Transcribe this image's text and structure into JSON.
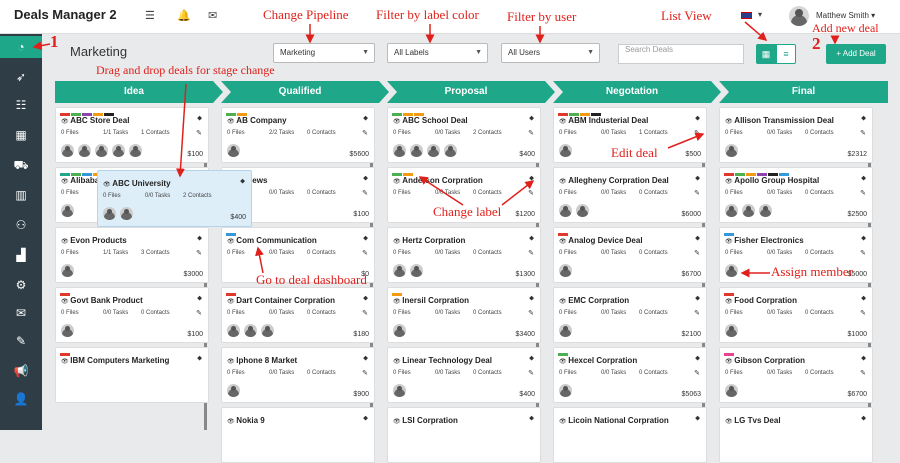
{
  "app": {
    "title": "Deals Manager 2"
  },
  "header": {
    "user_name": "Matthew Smith ▾",
    "flag_caret": "▾",
    "icons": [
      "hamburger-icon",
      "bell-icon",
      "mail-icon"
    ]
  },
  "sidebar": {
    "items": [
      "dashboard-icon",
      "rocket-icon",
      "sliders-icon",
      "calendar-icon",
      "cart-icon",
      "building-icon",
      "team-icon",
      "chart-icon",
      "gear-icon",
      "mail-icon",
      "tag-icon",
      "megaphone-icon",
      "user-icon"
    ]
  },
  "toolbar": {
    "page_title": "Marketing",
    "pipeline": "Marketing",
    "labels": "All Labels",
    "users": "All Users",
    "search_placeholder": "Search Deals",
    "add_deal": "+ Add Deal",
    "grid_icon": "▦",
    "list_icon": "≡"
  },
  "stages": [
    "Idea",
    "Qualified",
    "Proposal",
    "Negotation",
    "Final"
  ],
  "label_colors": {
    "red": "#e0392b",
    "green": "#4caf50",
    "orange": "#f39c12",
    "purple": "#8e44ad",
    "black": "#222222",
    "blue": "#3498db",
    "teal": "#1fa78a",
    "pink": "#e84393"
  },
  "columns": [
    {
      "cards": [
        {
          "title": "ABC Store Deal",
          "files": "0 Files",
          "tasks": "1/1 Tasks",
          "contacts": "1 Contacts",
          "amount": "$100",
          "labels": [
            "red",
            "green",
            "purple",
            "orange",
            "black"
          ],
          "avatars": 5
        },
        {
          "title": "Alibaba Website Marketing",
          "files": "0 Files",
          "tasks": "0/0 Tasks",
          "contacts": "0 Contacts",
          "amount": "$100",
          "labels": [
            "teal",
            "green",
            "blue",
            "orange"
          ],
          "avatars": 1
        },
        {
          "title": "Evon Products",
          "files": "0 Files",
          "tasks": "1/1 Tasks",
          "contacts": "3 Contacts",
          "amount": "$3000",
          "labels": [],
          "avatars": 1
        },
        {
          "title": "Govt Bank Product",
          "files": "0 Files",
          "tasks": "0/0 Tasks",
          "contacts": "0 Contacts",
          "amount": "$100",
          "labels": [
            "red"
          ],
          "avatars": 1
        },
        {
          "title": "IBM Computers Marketing",
          "files": "",
          "tasks": "",
          "contacts": "",
          "amount": "",
          "labels": [
            "red"
          ],
          "avatars": 0
        }
      ]
    },
    {
      "cards": [
        {
          "title": "AB Company",
          "files": "0 Files",
          "tasks": "2/2 Tasks",
          "contacts": "0 Contacts",
          "amount": "$5600",
          "labels": [
            "green",
            "orange"
          ],
          "avatars": 1
        },
        {
          "title": "IC News",
          "files": "0 Files",
          "tasks": "0/0 Tasks",
          "contacts": "0 Contacts",
          "amount": "$100",
          "labels": [],
          "avatars": 1
        },
        {
          "title": "Com Communication",
          "files": "0 Files",
          "tasks": "0/0 Tasks",
          "contacts": "0 Contacts",
          "amount": "$0",
          "labels": [
            "blue"
          ],
          "avatars": 0
        },
        {
          "title": "Dart Container Corpration",
          "files": "0 Files",
          "tasks": "0/0 Tasks",
          "contacts": "0 Contacts",
          "amount": "$180",
          "labels": [
            "red"
          ],
          "avatars": 3
        },
        {
          "title": "Iphone 8 Market",
          "files": "0 Files",
          "tasks": "0/0 Tasks",
          "contacts": "0 Contacts",
          "amount": "$900",
          "labels": [],
          "avatars": 1
        },
        {
          "title": "Nokia 9",
          "files": "",
          "tasks": "",
          "contacts": "",
          "amount": "",
          "labels": [],
          "avatars": 0
        }
      ]
    },
    {
      "cards": [
        {
          "title": "ABC School Deal",
          "files": "0 Files",
          "tasks": "0/0 Tasks",
          "contacts": "2 Contacts",
          "amount": "$400",
          "labels": [
            "green",
            "orange",
            "orange"
          ],
          "avatars": 4
        },
        {
          "title": "Anderson Corpration",
          "files": "0 Files",
          "tasks": "0/0 Tasks",
          "contacts": "0 Contacts",
          "amount": "$1200",
          "labels": [
            "green",
            "orange"
          ],
          "avatars": 0
        },
        {
          "title": "Hertz Corpration",
          "files": "0 Files",
          "tasks": "0/0 Tasks",
          "contacts": "0 Contacts",
          "amount": "$1300",
          "labels": [],
          "avatars": 2
        },
        {
          "title": "Inersil Corpration",
          "files": "0 Files",
          "tasks": "0/0 Tasks",
          "contacts": "0 Contacts",
          "amount": "$3400",
          "labels": [
            "orange"
          ],
          "avatars": 1
        },
        {
          "title": "Linear Technology Deal",
          "files": "0 Files",
          "tasks": "0/0 Tasks",
          "contacts": "0 Contacts",
          "amount": "$400",
          "labels": [],
          "avatars": 1
        },
        {
          "title": "LSI Corpration",
          "files": "",
          "tasks": "",
          "contacts": "",
          "amount": "",
          "labels": [],
          "avatars": 0
        }
      ]
    },
    {
      "cards": [
        {
          "title": "ABM Industerial Deal",
          "files": "0 Files",
          "tasks": "0/0 Tasks",
          "contacts": "1 Contacts",
          "amount": "$500",
          "labels": [
            "red",
            "green",
            "orange",
            "black"
          ],
          "avatars": 1
        },
        {
          "title": "Allegheny Corpration Deal",
          "files": "0 Files",
          "tasks": "0/0 Tasks",
          "contacts": "0 Contacts",
          "amount": "$6000",
          "labels": [],
          "avatars": 2
        },
        {
          "title": "Analog Device Deal",
          "files": "0 Files",
          "tasks": "0/0 Tasks",
          "contacts": "0 Contacts",
          "amount": "$6700",
          "labels": [
            "red"
          ],
          "avatars": 1
        },
        {
          "title": "EMC Corpration",
          "files": "0 Files",
          "tasks": "0/0 Tasks",
          "contacts": "0 Contacts",
          "amount": "$2100",
          "labels": [],
          "avatars": 1
        },
        {
          "title": "Hexcel Corpration",
          "files": "0 Files",
          "tasks": "0/0 Tasks",
          "contacts": "0 Contacts",
          "amount": "$5063",
          "labels": [
            "green"
          ],
          "avatars": 1
        },
        {
          "title": "Licoin National Corpration",
          "files": "",
          "tasks": "",
          "contacts": "",
          "amount": "",
          "labels": [],
          "avatars": 0
        }
      ]
    },
    {
      "cards": [
        {
          "title": "Allison Transmission Deal",
          "files": "0 Files",
          "tasks": "0/0 Tasks",
          "contacts": "0 Contacts",
          "amount": "$2312",
          "labels": [],
          "avatars": 1
        },
        {
          "title": "Apollo Group Hospital",
          "files": "0 Files",
          "tasks": "0/0 Tasks",
          "contacts": "0 Contacts",
          "amount": "$2500",
          "labels": [
            "red",
            "green",
            "orange",
            "purple",
            "black",
            "blue"
          ],
          "avatars": 3
        },
        {
          "title": "Fisher Electronics",
          "files": "0 Files",
          "tasks": "0/0 Tasks",
          "contacts": "0 Contacts",
          "amount": "$5000",
          "labels": [
            "blue"
          ],
          "avatars": 1
        },
        {
          "title": "Food Corpration",
          "files": "0 Files",
          "tasks": "0/0 Tasks",
          "contacts": "0 Contacts",
          "amount": "$1000",
          "labels": [
            "red"
          ],
          "avatars": 1
        },
        {
          "title": "Gibson Corpration",
          "files": "0 Files",
          "tasks": "0/0 Tasks",
          "contacts": "0 Contacts",
          "amount": "$6700",
          "labels": [
            "pink"
          ],
          "avatars": 1
        },
        {
          "title": "LG Tvs Deal",
          "files": "",
          "tasks": "",
          "contacts": "",
          "amount": "",
          "labels": [],
          "avatars": 0
        }
      ]
    }
  ],
  "drag_card": {
    "title": "ABC University",
    "files": "0 Files",
    "tasks": "0/0 Tasks",
    "contacts": "2 Contacts",
    "amount": "$400",
    "avatars": 2
  },
  "annotations": {
    "change_pipeline": "Change Pipeline",
    "filter_label": "Filter by label color",
    "filter_user": "Filter by user",
    "list_view": "List View",
    "add_new_deal": "Add new deal",
    "num1": "1",
    "num2": "2",
    "drag_drop": "Drag and drop deals for stage change",
    "edit_deal": "Edit deal",
    "change_label": "Change label",
    "go_dashboard": "Go to deal dashboard",
    "assign_member": "Assign member"
  }
}
